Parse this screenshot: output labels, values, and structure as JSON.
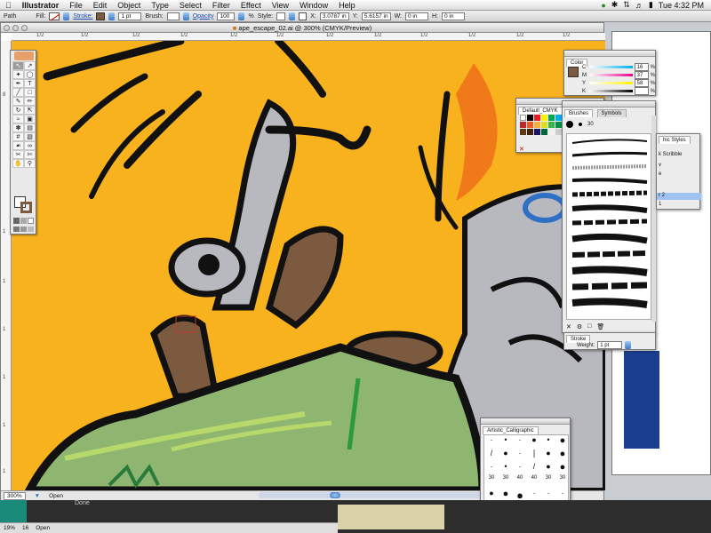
{
  "menubar": {
    "app_name": "Illustrator",
    "items": [
      "File",
      "Edit",
      "Object",
      "Type",
      "Select",
      "Filter",
      "Effect",
      "View",
      "Window",
      "Help"
    ],
    "clock": "Tue 4:32 PM"
  },
  "controlbar": {
    "object_type": "Path",
    "fill_label": "Fill:",
    "stroke_label": "Stroke:",
    "stroke_weight": "1 pt",
    "brush_label": "Brush:",
    "opacity_label": "Opacity",
    "opacity_value": "100",
    "opacity_unit": "%",
    "style_label": "Style:",
    "x_label": "X:",
    "x_value": "3.0787 in",
    "y_label": "Y:",
    "y_value": "5.6157 in",
    "w_label": "W:",
    "w_value": "0 in",
    "h_label": "H:",
    "h_value": "0 in"
  },
  "document": {
    "title": "ape_escape_02.ai @ 300% (CMYK/Preview)",
    "zoom": "300%",
    "status_label": "Open",
    "ruler_labels": [
      "1/2",
      "1/2",
      "1/2",
      "1/2",
      "1/2",
      "1/2",
      "1/2",
      "1/2",
      "1/2",
      "1/2",
      "1/2",
      "1/2",
      "1/2"
    ],
    "left_ruler_labels": [
      "8",
      "1",
      "1",
      "1",
      "1",
      "1",
      "1",
      "1",
      "1"
    ]
  },
  "panels": {
    "color": {
      "tab": "Color",
      "channels": [
        {
          "name": "C",
          "value": "16",
          "unit": "%"
        },
        {
          "name": "M",
          "value": "37",
          "unit": "%"
        },
        {
          "name": "Y",
          "value": "58",
          "unit": "%"
        },
        {
          "name": "K",
          "value": "",
          "unit": "%"
        }
      ]
    },
    "swatches": {
      "tab": "Default_CMYK"
    },
    "brushes": {
      "tab": "Brushes",
      "tab2": "Symbols",
      "size_label": "30"
    },
    "graphic_styles": {
      "tab": "hic Styles",
      "item1": "k Scribble",
      "item2": "v",
      "item3": "e",
      "layer_label": "r 2",
      "layer_index": "1"
    },
    "stroke": {
      "tab": "Stroke",
      "weight_label": "Weight:",
      "weight_value": "1 pt"
    },
    "artistic_calligraphic": {
      "tab": "Artistic_Calligraphic",
      "numbers": [
        "30",
        "30",
        "40",
        "40",
        "30",
        "30",
        "30",
        "50",
        "50",
        "50"
      ]
    }
  },
  "statusbar": {
    "zoom": "19%",
    "page": "16",
    "mode": "Open",
    "done": "Done"
  },
  "colors": {
    "background_orange": "#f8b21d",
    "ape_gray": "#b8b9bf",
    "ape_brown": "#7c5a40",
    "hat_green": "#8fb670",
    "outline_black": "#111111",
    "accent_blue": "#2f6fc4"
  }
}
